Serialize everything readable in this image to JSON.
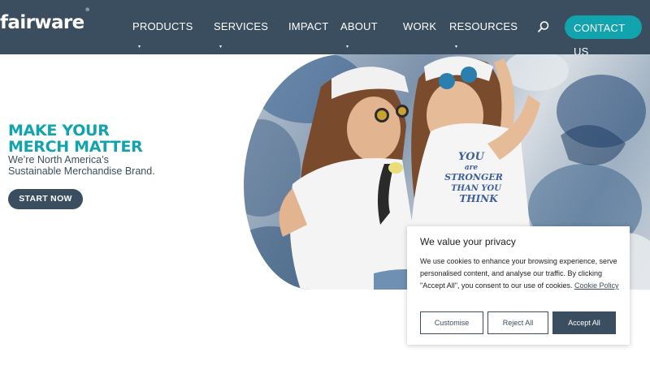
{
  "header": {
    "logo": "fairware",
    "logo_mark": "®",
    "nav": [
      {
        "label": "PRODUCTS",
        "has_dropdown": true
      },
      {
        "label": "SERVICES",
        "has_dropdown": true
      },
      {
        "label": "IMPACT",
        "has_dropdown": false
      },
      {
        "label": "ABOUT",
        "has_dropdown": true
      },
      {
        "label": "WORK",
        "has_dropdown": false
      },
      {
        "label": "RESOURCES",
        "has_dropdown": true
      }
    ],
    "caret": "▾",
    "search_icon": "search-icon",
    "contact_line1": "CONTACT",
    "contact_line2": "US"
  },
  "hero": {
    "headline_line1": "MAKE YOUR",
    "headline_line2": "MERCH MATTER",
    "subhead_line1": "We’re North America’s",
    "subhead_line2": "Sustainable Merchandise Brand.",
    "cta": "START NOW",
    "shirt_text_line1": "YOU",
    "shirt_text_line2": "are",
    "shirt_text_line3": "STRONGER",
    "shirt_text_line4": "THAN YOU",
    "shirt_text_line5": "THINK"
  },
  "cookie": {
    "title": "We value your privacy",
    "body": "We use cookies to enhance your browsing experience, serve personalised content, and analyse our traffic. By clicking \"Accept All\", you consent to our use of cookies.",
    "link": "Cookie Policy",
    "customise": "Customise",
    "reject": "Reject All",
    "accept": "Accept All"
  },
  "colors": {
    "header_bg": "#3b4e5f",
    "accent_teal": "#11a3ae",
    "text_dark": "#3b4e5f"
  }
}
